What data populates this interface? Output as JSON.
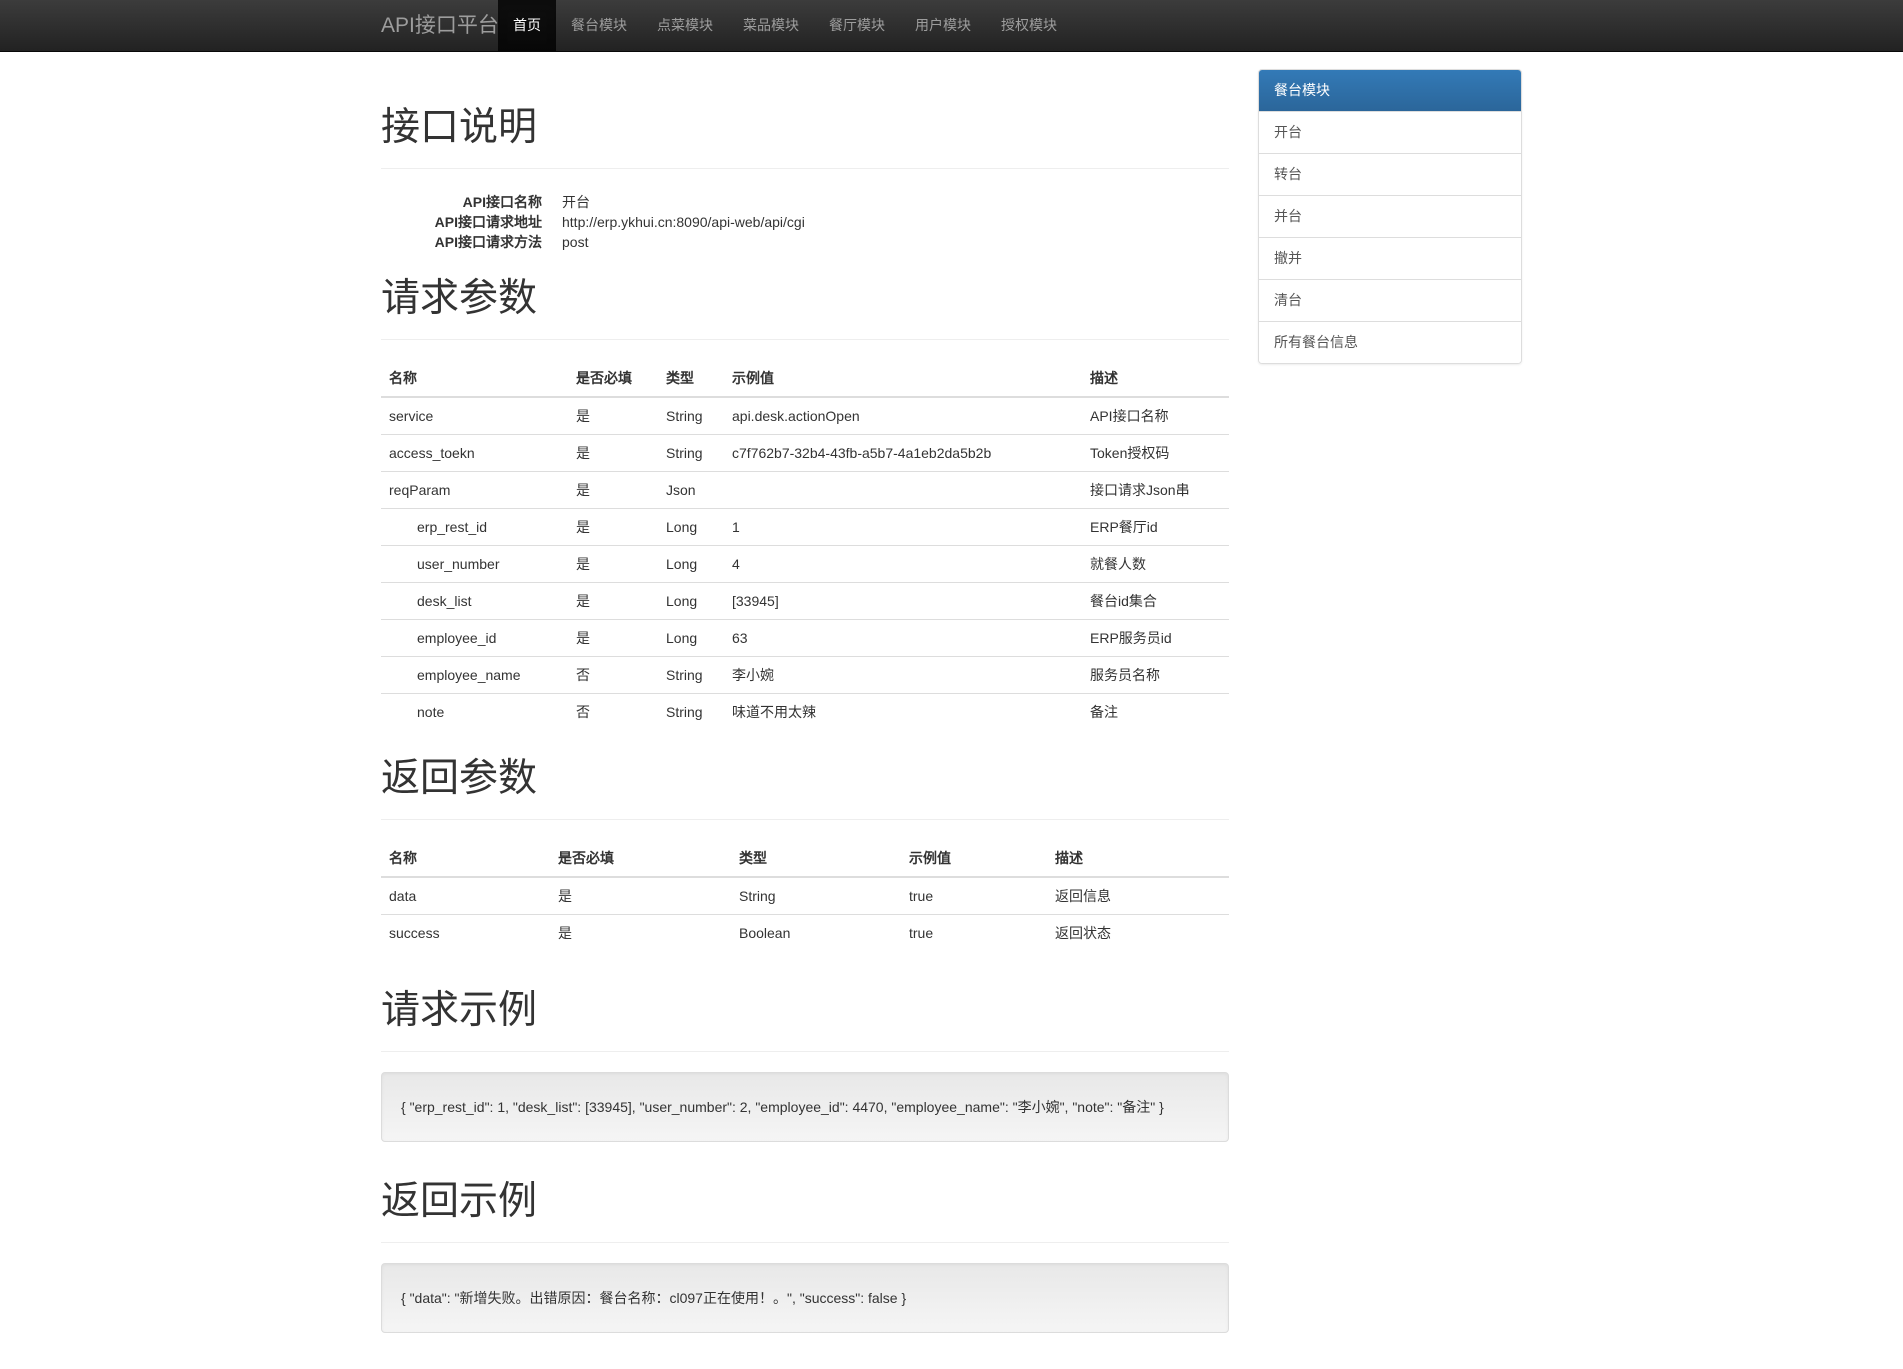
{
  "navbar": {
    "brand": "API接口平台",
    "items": [
      {
        "label": "首页",
        "active": true
      },
      {
        "label": "餐台模块"
      },
      {
        "label": "点菜模块"
      },
      {
        "label": "菜品模块"
      },
      {
        "label": "餐厅模块"
      },
      {
        "label": "用户模块"
      },
      {
        "label": "授权模块"
      }
    ]
  },
  "sections": {
    "interface_title": "接口说明",
    "request_params_title": "请求参数",
    "response_params_title": "返回参数",
    "request_example_title": "请求示例",
    "response_example_title": "返回示例"
  },
  "api_info": [
    {
      "key": "API接口名称",
      "value": "开台"
    },
    {
      "key": "API接口请求地址",
      "value": "http://erp.ykhui.cn:8090/api-web/api/cgi"
    },
    {
      "key": "API接口请求方法",
      "value": "post"
    }
  ],
  "request_table": {
    "headers": [
      "名称",
      "是否必填",
      "类型",
      "示例值",
      "描述"
    ],
    "rows": [
      {
        "name": "service",
        "required": "是",
        "type": "String",
        "example": "api.desk.actionOpen",
        "desc": "API接口名称",
        "indent": false
      },
      {
        "name": "access_toekn",
        "required": "是",
        "type": "String",
        "example": "c7f762b7-32b4-43fb-a5b7-4a1eb2da5b2b",
        "desc": "Token授权码",
        "indent": false
      },
      {
        "name": "reqParam",
        "required": "是",
        "type": "Json",
        "example": "",
        "desc": "接口请求Json串",
        "indent": false
      },
      {
        "name": "erp_rest_id",
        "required": "是",
        "type": "Long",
        "example": "1",
        "desc": "ERP餐厅id",
        "indent": true
      },
      {
        "name": "user_number",
        "required": "是",
        "type": "Long",
        "example": "4",
        "desc": "就餐人数",
        "indent": true
      },
      {
        "name": "desk_list",
        "required": "是",
        "type": "Long",
        "example": "[33945]",
        "desc": "餐台id集合",
        "indent": true
      },
      {
        "name": "employee_id",
        "required": "是",
        "type": "Long",
        "example": "63",
        "desc": "ERP服务员id",
        "indent": true
      },
      {
        "name": "employee_name",
        "required": "否",
        "type": "String",
        "example": "李小婉",
        "desc": "服务员名称",
        "indent": true
      },
      {
        "name": "note",
        "required": "否",
        "type": "String",
        "example": "味道不用太辣",
        "desc": "备注",
        "indent": true
      }
    ]
  },
  "response_table": {
    "headers": [
      "名称",
      "是否必填",
      "类型",
      "示例值",
      "描述"
    ],
    "rows": [
      {
        "name": "data",
        "required": "是",
        "type": "String",
        "example": "true",
        "desc": "返回信息"
      },
      {
        "name": "success",
        "required": "是",
        "type": "Boolean",
        "example": "true",
        "desc": "返回状态"
      }
    ]
  },
  "request_example": "{ \"erp_rest_id\": 1, \"desk_list\": [33945], \"user_number\": 2, \"employee_id\": 4470, \"employee_name\": \"李小婉\", \"note\": \"备注\" }",
  "response_example": "{ \"data\": \"新增失败。出错原因：餐台名称：cl097正在使用！。\", \"success\": false }",
  "sidebar": {
    "header": "餐台模块",
    "items": [
      {
        "label": "开台"
      },
      {
        "label": "转台"
      },
      {
        "label": "并台"
      },
      {
        "label": "撤并"
      },
      {
        "label": "清台"
      },
      {
        "label": "所有餐台信息"
      }
    ]
  }
}
